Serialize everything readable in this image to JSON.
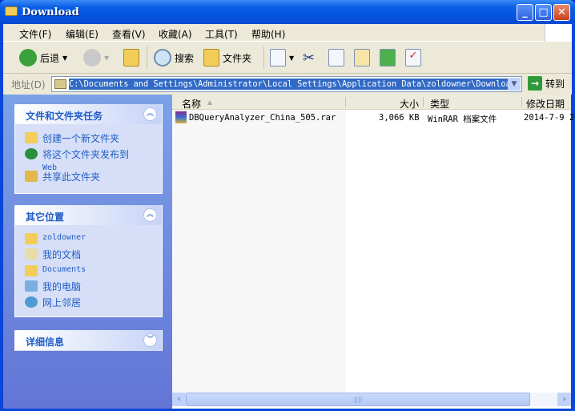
{
  "window": {
    "title": "Download"
  },
  "menu": [
    "文件(F)",
    "编辑(E)",
    "查看(V)",
    "收藏(A)",
    "工具(T)",
    "帮助(H)"
  ],
  "toolbar": {
    "back": "后退",
    "search": "搜索",
    "folders": "文件夹"
  },
  "address": {
    "label": "地址(D)",
    "path": "C:\\Documents and Settings\\Administrator\\Local Settings\\Application Data\\zoldowner\\Download",
    "go": "转到"
  },
  "tasks": {
    "title": "文件和文件夹任务",
    "items": [
      "创建一个新文件夹",
      "将这个文件夹发布到",
      "共享此文件夹"
    ],
    "web": "Web"
  },
  "places": {
    "title": "其它位置",
    "items": [
      "zoldowner",
      "我的文档",
      "Documents",
      "我的电脑",
      "网上邻居"
    ]
  },
  "details": {
    "title": "详细信息"
  },
  "columns": {
    "name": "名称",
    "size": "大小",
    "type": "类型",
    "modified": "修改日期"
  },
  "files": [
    {
      "name": "DBQueryAnalyzer_China_505.rar",
      "size": "3,066 KB",
      "type": "WinRAR 档案文件",
      "modified": "2014-7-9 2"
    }
  ],
  "colors": {
    "titlebar": "#0a5ee6",
    "sidebar": "#7ba2e7",
    "selection": "#316ac5"
  }
}
